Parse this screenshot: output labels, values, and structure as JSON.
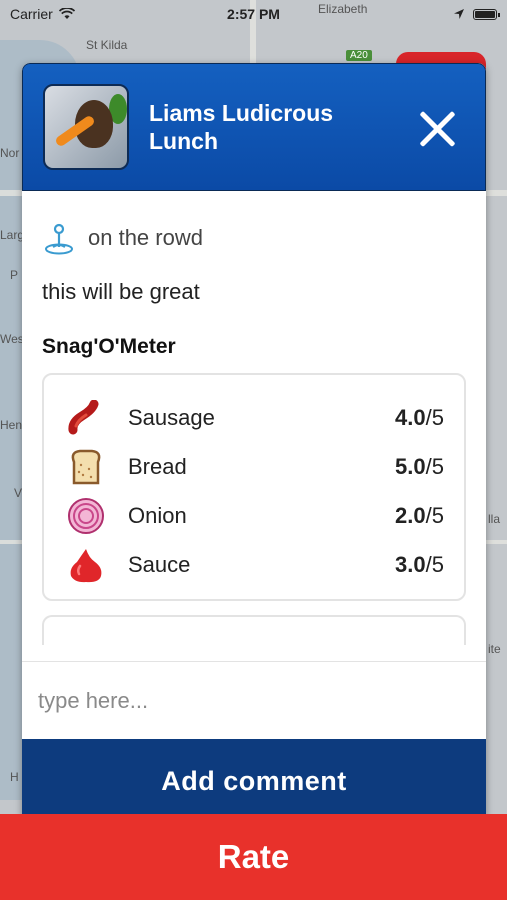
{
  "status_bar": {
    "carrier": "Carrier",
    "time": "2:57 PM",
    "battery_level": 1.0
  },
  "map": {
    "labels": [
      "St Kilda",
      "Elizabeth",
      "A20",
      "Nor",
      "Larg",
      "P",
      "Wes",
      "Hen",
      "V",
      "H",
      "lla",
      "ite"
    ]
  },
  "modal": {
    "title": "Liams Ludicrous Lunch",
    "location_icon": "map-pin-icon",
    "location": "on the rowd",
    "description": "this will be great",
    "meter_title": "Snag'O'Meter",
    "ratings": [
      {
        "name": "Sausage",
        "score": "4.0",
        "max": "/5",
        "icon": "sausage-icon"
      },
      {
        "name": "Bread",
        "score": "5.0",
        "max": "/5",
        "icon": "bread-icon"
      },
      {
        "name": "Onion",
        "score": "2.0",
        "max": "/5",
        "icon": "onion-icon"
      },
      {
        "name": "Sauce",
        "score": "3.0",
        "max": "/5",
        "icon": "sauce-icon"
      }
    ],
    "comment_placeholder": "type here...",
    "add_comment_label": "Add comment"
  },
  "rate_label": "Rate",
  "colors": {
    "header_blue": "#1460c0",
    "add_comment_blue": "#0d3b7e",
    "rate_red": "#e8312b"
  }
}
